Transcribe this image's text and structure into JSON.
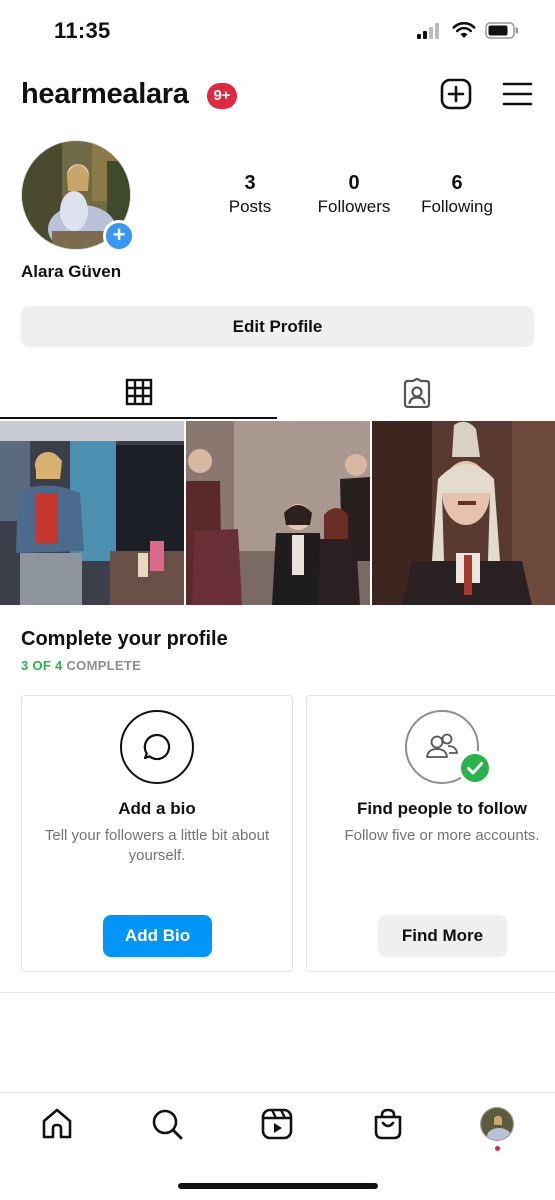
{
  "status_bar": {
    "time": "11:35"
  },
  "header": {
    "username": "hearmealara",
    "notification_badge": "9+"
  },
  "profile": {
    "display_name": "Alara Güven",
    "stats": [
      {
        "value": "3",
        "label": "Posts"
      },
      {
        "value": "0",
        "label": "Followers"
      },
      {
        "value": "6",
        "label": "Following"
      }
    ],
    "edit_button_label": "Edit Profile"
  },
  "tabs": [
    {
      "icon": "grid-icon",
      "active": true
    },
    {
      "icon": "tagged-icon",
      "active": false
    }
  ],
  "complete_profile": {
    "title": "Complete your profile",
    "progress_done": "3 OF 4",
    "progress_word": "COMPLETE",
    "progress_fraction": 0.75,
    "cards": [
      {
        "icon": "speech-bubble-icon",
        "title": "Add a bio",
        "description": "Tell your followers a little bit about yourself.",
        "button_label": "Add Bio",
        "completed": false
      },
      {
        "icon": "people-icon",
        "title": "Find people to follow",
        "description": "Follow five or more accounts.",
        "button_label": "Find More",
        "completed": true
      }
    ]
  },
  "bottom_nav": [
    "home-icon",
    "search-icon",
    "reels-icon",
    "shop-icon",
    "profile-avatar"
  ],
  "colors": {
    "accent_blue": "#0095f6",
    "badge_red": "#e0283e",
    "complete_green": "#2bb24c"
  }
}
